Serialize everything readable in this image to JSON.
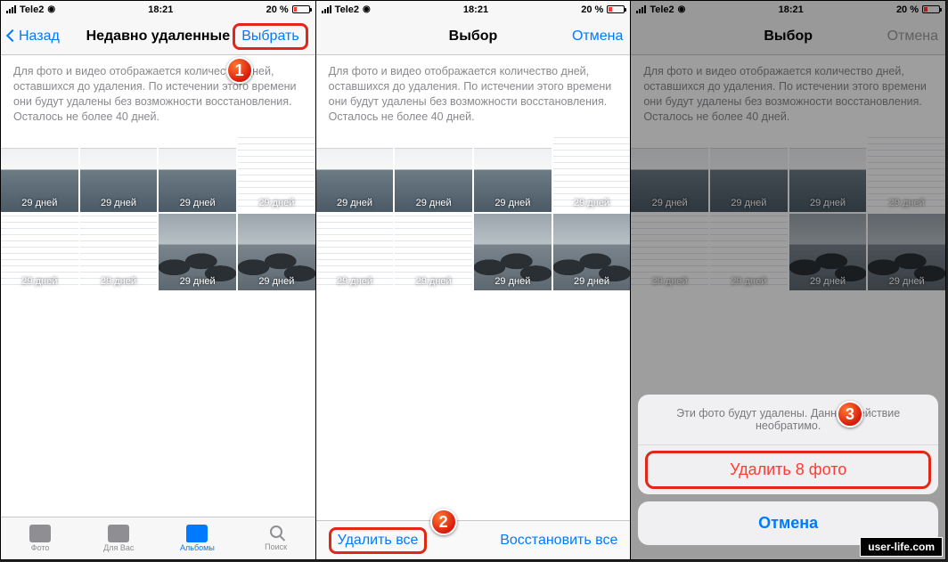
{
  "status": {
    "carrier": "Tele2",
    "time": "18:21",
    "battery_pct": "20 %"
  },
  "screen1": {
    "back": "Назад",
    "title": "Недавно удаленные",
    "select": "Выбрать"
  },
  "screen2": {
    "title": "Выбор",
    "cancel": "Отмена",
    "delete_all": "Удалить все",
    "restore_all": "Восстановить все"
  },
  "screen3": {
    "title": "Выбор",
    "cancel": "Отмена",
    "sheet_msg": "Эти фото будут удалены. Данное действие необратимо.",
    "delete_n": "Удалить 8 фото",
    "sheet_cancel": "Отмена"
  },
  "info_text": "Для фото и видео отображается количество дней, оставшихся до удаления. По истечении этого времени они будут удалены без возможности восстановления. Осталось не более 40 дней.",
  "days_label": "29 дней",
  "tabs": {
    "photo": "Фото",
    "foryou": "Для Вас",
    "albums": "Альбомы",
    "search": "Поиск"
  },
  "steps": {
    "s1": "1",
    "s2": "2",
    "s3": "3"
  },
  "watermark": "user-life.com"
}
